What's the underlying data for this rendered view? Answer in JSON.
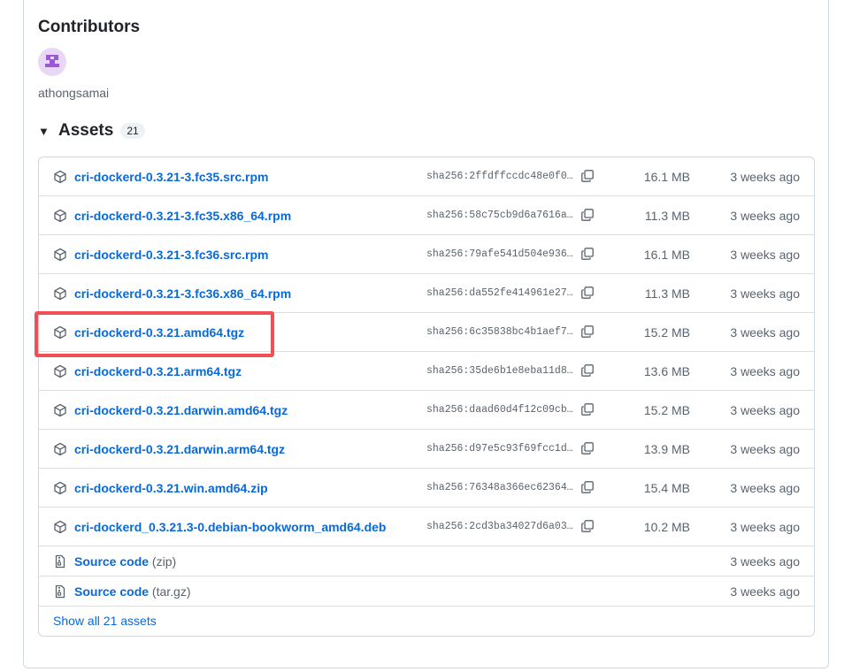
{
  "contributors": {
    "title": "Contributors",
    "users": [
      {
        "name": "athongsamai"
      }
    ]
  },
  "assets": {
    "title": "Assets",
    "count": "21",
    "items": [
      {
        "name": "cri-dockerd-0.3.21-3.fc35.src.rpm",
        "sha": "sha256:2ffdffccdc48e0f0f…",
        "size": "16.1 MB",
        "date": "3 weeks ago"
      },
      {
        "name": "cri-dockerd-0.3.21-3.fc35.x86_64.rpm",
        "sha": "sha256:58c75cb9d6a7616a5…",
        "size": "11.3 MB",
        "date": "3 weeks ago"
      },
      {
        "name": "cri-dockerd-0.3.21-3.fc36.src.rpm",
        "sha": "sha256:79afe541d504e9360…",
        "size": "16.1 MB",
        "date": "3 weeks ago"
      },
      {
        "name": "cri-dockerd-0.3.21-3.fc36.x86_64.rpm",
        "sha": "sha256:da552fe414961e279…",
        "size": "11.3 MB",
        "date": "3 weeks ago"
      },
      {
        "name": "cri-dockerd-0.3.21.amd64.tgz",
        "sha": "sha256:6c35838bc4b1aef74…",
        "size": "15.2 MB",
        "date": "3 weeks ago"
      },
      {
        "name": "cri-dockerd-0.3.21.arm64.tgz",
        "sha": "sha256:35de6b1e8eba11d8b…",
        "size": "13.6 MB",
        "date": "3 weeks ago"
      },
      {
        "name": "cri-dockerd-0.3.21.darwin.amd64.tgz",
        "sha": "sha256:daad60d4f12c09cb8…",
        "size": "15.2 MB",
        "date": "3 weeks ago"
      },
      {
        "name": "cri-dockerd-0.3.21.darwin.arm64.tgz",
        "sha": "sha256:d97e5c93f69fcc1d1…",
        "size": "13.9 MB",
        "date": "3 weeks ago"
      },
      {
        "name": "cri-dockerd-0.3.21.win.amd64.zip",
        "sha": "sha256:76348a366ec623646…",
        "size": "15.4 MB",
        "date": "3 weeks ago"
      },
      {
        "name": "cri-dockerd_0.3.21.3-0.debian-bookworm_amd64.deb",
        "sha": "sha256:2cd3ba34027d6a033…",
        "size": "10.2 MB",
        "date": "3 weeks ago"
      }
    ],
    "source": [
      {
        "label": "Source code",
        "suffix": "(zip)",
        "date": "3 weeks ago"
      },
      {
        "label": "Source code",
        "suffix": "(tar.gz)",
        "date": "3 weeks ago"
      }
    ],
    "show_all": "Show all 21 assets"
  },
  "colors": {
    "link": "#0969da",
    "highlight": "#f04f55",
    "muted": "#59636e"
  },
  "icons": {
    "asset": "package-icon",
    "source": "file-zip-icon",
    "copy": "copy-icon",
    "toggle": "triangle-down-icon"
  }
}
